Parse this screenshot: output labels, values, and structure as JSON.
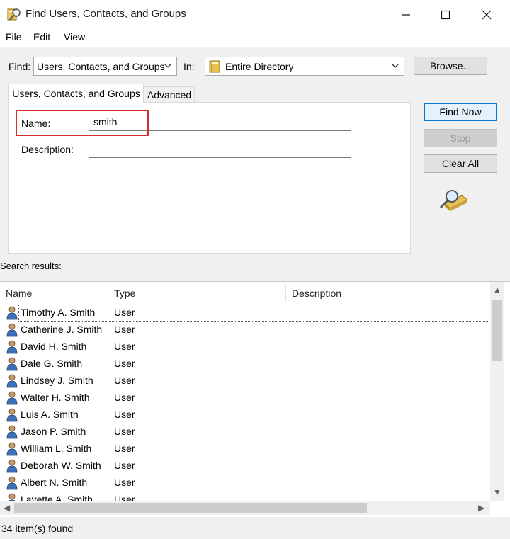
{
  "window": {
    "title": "Find Users, Contacts, and Groups",
    "controls": {
      "minimize": "–",
      "maximize": "☐",
      "close": "✕"
    }
  },
  "menu": {
    "items": [
      "File",
      "Edit",
      "View"
    ]
  },
  "search_bar": {
    "find_label": "Find:",
    "find_value": "Users, Contacts, and Groups",
    "in_label": "In:",
    "in_value": "Entire Directory",
    "browse_label": "Browse..."
  },
  "tabs": [
    {
      "label": "Users, Contacts, and Groups",
      "active": true
    },
    {
      "label": "Advanced",
      "active": false
    }
  ],
  "form": {
    "name_label": "Name:",
    "name_value": "smith",
    "description_label": "Description:",
    "description_value": ""
  },
  "actions": {
    "find_now": "Find Now",
    "stop": "Stop",
    "clear_all": "Clear All",
    "search_icon": "magnifier-over-book-icon"
  },
  "results": {
    "label": "Search results:",
    "columns": [
      "Name",
      "Type",
      "Description"
    ],
    "rows": [
      {
        "name": "Timothy A. Smith",
        "type": "User"
      },
      {
        "name": "Catherine J. Smith",
        "type": "User"
      },
      {
        "name": "David H. Smith",
        "type": "User"
      },
      {
        "name": "Dale G. Smith",
        "type": "User"
      },
      {
        "name": "Lindsey J. Smith",
        "type": "User"
      },
      {
        "name": "Walter H. Smith",
        "type": "User"
      },
      {
        "name": "Luis A. Smith",
        "type": "User"
      },
      {
        "name": "Jason P. Smith",
        "type": "User"
      },
      {
        "name": "William L. Smith",
        "type": "User"
      },
      {
        "name": "Deborah W. Smith",
        "type": "User"
      },
      {
        "name": "Albert N. Smith",
        "type": "User"
      },
      {
        "name": "Lavette A. Smith",
        "type": "User"
      }
    ]
  },
  "status": {
    "text": "34 item(s) found"
  },
  "colors": {
    "accent": "#0078d7",
    "highlight": "#d32f2f"
  }
}
